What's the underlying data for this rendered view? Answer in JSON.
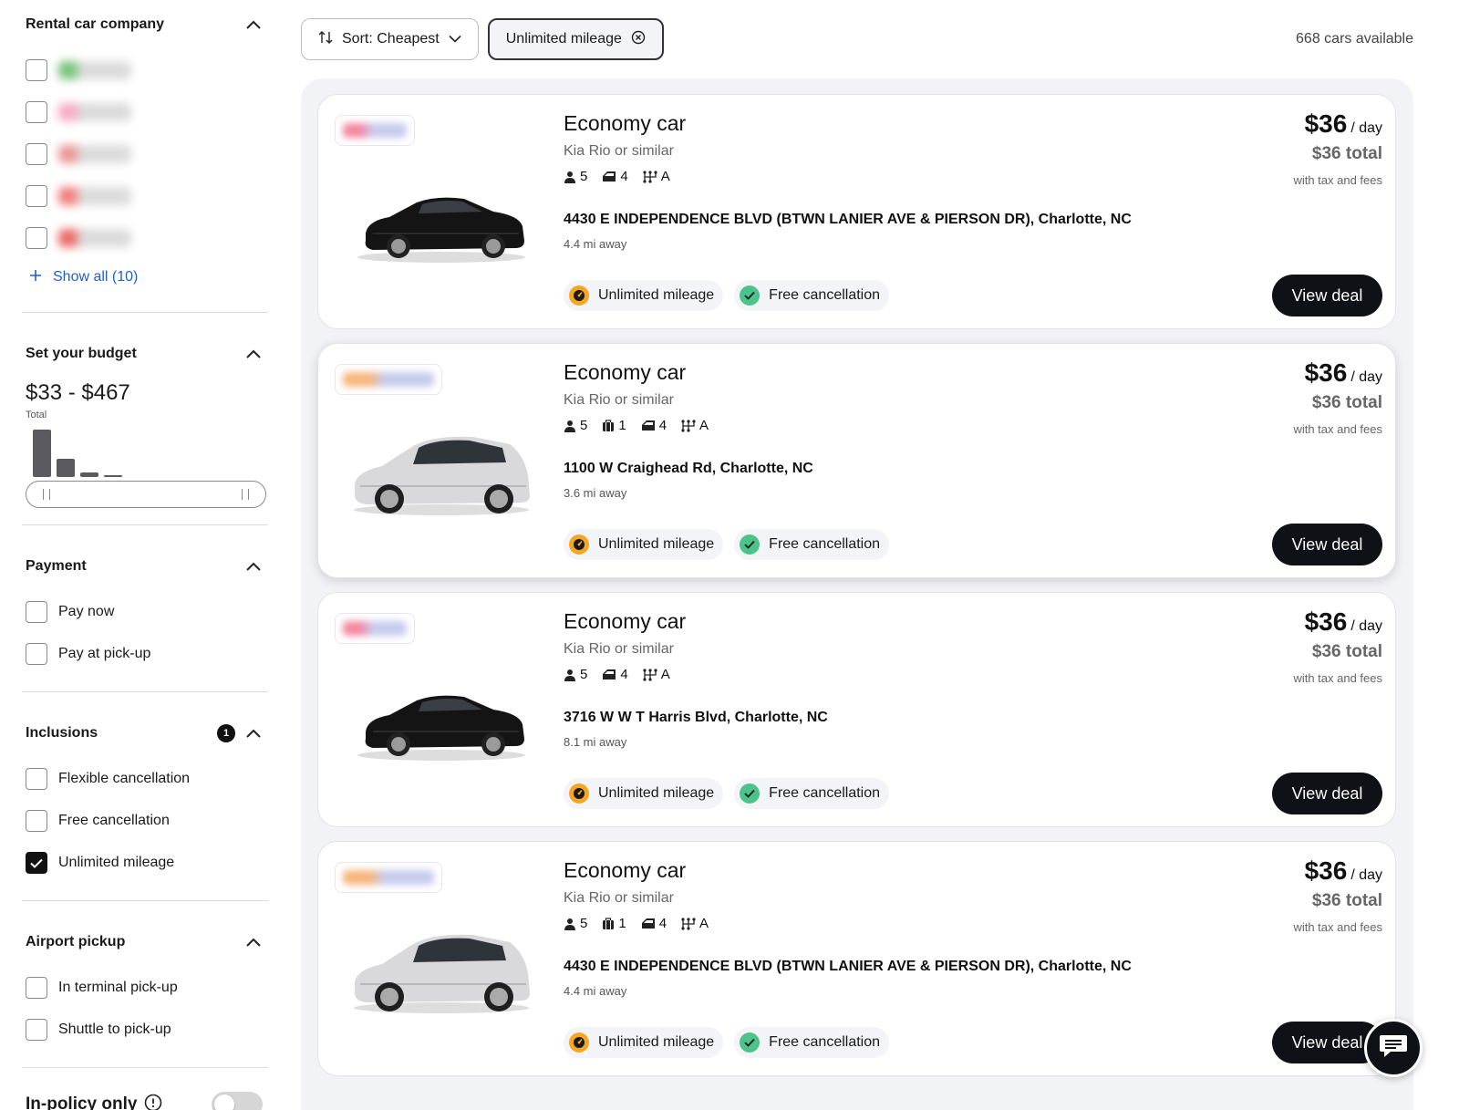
{
  "sidebar": {
    "rental_company": {
      "title": "Rental car company",
      "options": [
        {
          "color": "#4caf50"
        },
        {
          "color": "#f48fb1"
        },
        {
          "color": "#e57373"
        },
        {
          "color": "#ef5350"
        },
        {
          "color": "#e53935"
        }
      ],
      "show_all": "Show all (10)"
    },
    "budget": {
      "title": "Set your budget",
      "range": "$33 - $467",
      "sub": "Total",
      "histogram": [
        1.0,
        0.38,
        0.1,
        0.03
      ]
    },
    "payment": {
      "title": "Payment",
      "options": [
        {
          "label": "Pay now",
          "checked": false
        },
        {
          "label": "Pay at pick-up",
          "checked": false
        }
      ]
    },
    "inclusions": {
      "title": "Inclusions",
      "count": "1",
      "options": [
        {
          "label": "Flexible cancellation",
          "checked": false
        },
        {
          "label": "Free cancellation",
          "checked": false
        },
        {
          "label": "Unlimited mileage",
          "checked": true
        }
      ]
    },
    "airport": {
      "title": "Airport pickup",
      "options": [
        {
          "label": "In terminal pick-up",
          "checked": false
        },
        {
          "label": "Shuttle to pick-up",
          "checked": false
        }
      ]
    },
    "policy": {
      "label": "In-policy only",
      "enabled": false
    }
  },
  "toolbar": {
    "sort_label": "Sort: Cheapest",
    "filter_chip": "Unlimited mileage",
    "count": "668 cars available"
  },
  "cards": [
    {
      "title": "Economy car",
      "model": "Kia Rio or similar",
      "seats": "5",
      "bags": null,
      "doors": "4",
      "trans": "A",
      "address": "4430 E INDEPENDENCE BLVD (BTWN LANIER AVE & PIERSON DR), Charlotte, NC",
      "distance": "4.4 mi away",
      "badge1": "Unlimited mileage",
      "badge2": "Free cancellation",
      "price": "$36",
      "per": "/ day",
      "total": "$36 total",
      "tax": "with tax and fees",
      "cta": "View deal",
      "car": "black-sedan",
      "logo_color": "#f06b8a"
    },
    {
      "title": "Economy car",
      "model": "Kia Rio or similar",
      "seats": "5",
      "bags": "1",
      "doors": "4",
      "trans": "A",
      "address": "1100 W Craighead Rd, Charlotte, NC",
      "distance": "3.6 mi away",
      "badge1": "Unlimited mileage",
      "badge2": "Free cancellation",
      "price": "$36",
      "per": "/ day",
      "total": "$36 total",
      "tax": "with tax and fees",
      "cta": "View deal",
      "car": "silver-hatchback",
      "logo_color": "#f5a25d"
    },
    {
      "title": "Economy car",
      "model": "Kia Rio or similar",
      "seats": "5",
      "bags": null,
      "doors": "4",
      "trans": "A",
      "address": "3716 W W T Harris Blvd, Charlotte, NC",
      "distance": "8.1 mi away",
      "badge1": "Unlimited mileage",
      "badge2": "Free cancellation",
      "price": "$36",
      "per": "/ day",
      "total": "$36 total",
      "tax": "with tax and fees",
      "cta": "View deal",
      "car": "black-sedan",
      "logo_color": "#f06b8a"
    },
    {
      "title": "Economy car",
      "model": "Kia Rio or similar",
      "seats": "5",
      "bags": "1",
      "doors": "4",
      "trans": "A",
      "address": "4430 E INDEPENDENCE BLVD (BTWN LANIER AVE & PIERSON DR), Charlotte, NC",
      "distance": "4.4 mi away",
      "badge1": "Unlimited mileage",
      "badge2": "Free cancellation",
      "price": "$36",
      "per": "/ day",
      "total": "$36 total",
      "tax": "with tax and fees",
      "cta": "View deal",
      "car": "silver-hatchback",
      "logo_color": "#f5a25d"
    }
  ],
  "colors": {
    "accent": "#1f5fd1",
    "mileage_badge": "#f5a623",
    "cancel_badge": "#4cc38a",
    "cta_bg": "#0e1116"
  }
}
